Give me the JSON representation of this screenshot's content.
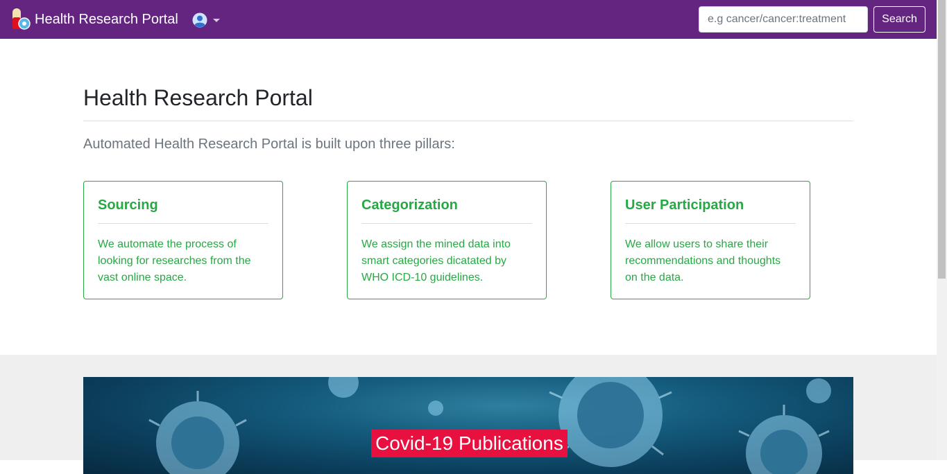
{
  "navbar": {
    "brand": "Health Research Portal",
    "search_placeholder": "e.g cancer/cancer:treatment",
    "search_button": "Search"
  },
  "hero": {
    "title": "Health Research Portal",
    "lead": "Automated Health Research Portal is built upon three pillars:"
  },
  "pillars": [
    {
      "title": "Sourcing",
      "text": "We automate the process of looking for researches from the vast online space."
    },
    {
      "title": "Categorization",
      "text": "We assign the mined data into smart categories dicatated by WHO ICD-10 guidelines."
    },
    {
      "title": "User Participation",
      "text": "We allow users to share their recommendations and thoughts on the data."
    }
  ],
  "banner": {
    "title": "Covid-19 Publications"
  },
  "colors": {
    "navbar": "#63257f",
    "accent": "#28a745",
    "banner_label": "#e8103f"
  }
}
